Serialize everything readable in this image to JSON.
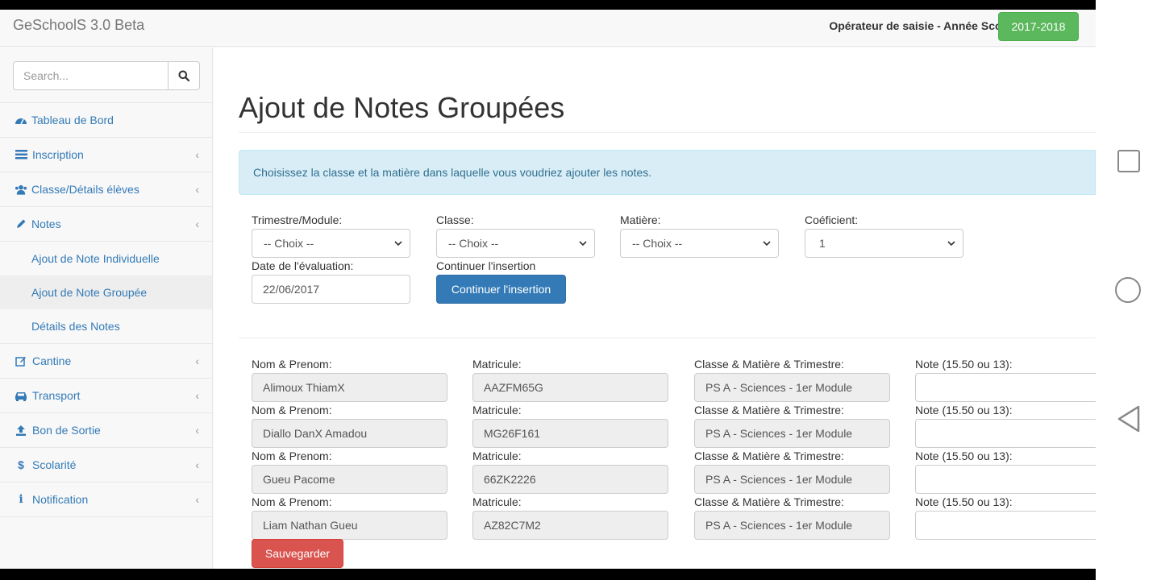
{
  "app": {
    "brand": "GeSchoolS 3.0 Beta",
    "operator_label": "Opérateur de saisie - Année Scolaire:",
    "school_year": "2017-2018"
  },
  "sidebar": {
    "search_placeholder": "Search...",
    "items": [
      {
        "label": "Tableau de Bord",
        "icon": "dashboard-icon",
        "expandable": false
      },
      {
        "label": "Inscription",
        "icon": "list-icon",
        "expandable": true
      },
      {
        "label": "Classe/Détails élèves",
        "icon": "users-icon",
        "expandable": true
      },
      {
        "label": "Notes",
        "icon": "pencil-icon",
        "expandable": true
      },
      {
        "label": "Cantine",
        "icon": "edit-icon",
        "expandable": true
      },
      {
        "label": "Transport",
        "icon": "car-icon",
        "expandable": true
      },
      {
        "label": "Bon de Sortie",
        "icon": "upload-icon",
        "expandable": true
      },
      {
        "label": "Scolarité",
        "icon": "dollar-icon",
        "expandable": true
      },
      {
        "label": "Notification",
        "icon": "info-icon",
        "expandable": true
      }
    ],
    "notes_submenu": [
      {
        "label": "Ajout de Note Individuelle",
        "active": false
      },
      {
        "label": "Ajout de Note Groupée",
        "active": true
      },
      {
        "label": "Détails des Notes",
        "active": false
      }
    ]
  },
  "page": {
    "title": "Ajout de Notes Groupées",
    "alert": "Choisissez la classe et la matière dans laquelle vous voudriez ajouter les notes."
  },
  "filters": {
    "trimestre_label": "Trimestre/Module:",
    "trimestre_value": "-- Choix --",
    "classe_label": "Classe:",
    "classe_value": "-- Choix --",
    "matiere_label": "Matière:",
    "matiere_value": "-- Choix --",
    "coef_label": "Coéficient:",
    "coef_value": "1",
    "date_label": "Date de l'évaluation:",
    "date_value": "22/06/2017",
    "continue_label": "Continuer l'insertion",
    "continue_button": "Continuer l'insertion"
  },
  "students": {
    "name_label": "Nom & Prenom:",
    "matricule_label": "Matricule:",
    "context_label": "Classe & Matière & Trimestre:",
    "note_label": "Note (15.50 ou 13):",
    "rows": [
      {
        "name": "Alimoux ThiamX",
        "matricule": "AAZFM65G",
        "context": "PS A - Sciences - 1er Module",
        "note": ""
      },
      {
        "name": "Diallo DanX Amadou",
        "matricule": "MG26F161",
        "context": "PS A - Sciences - 1er Module",
        "note": ""
      },
      {
        "name": "Gueu Pacome",
        "matricule": "66ZK2226",
        "context": "PS A - Sciences - 1er Module",
        "note": ""
      },
      {
        "name": "Liam Nathan Gueu",
        "matricule": "AZ82C7M2",
        "context": "PS A - Sciences - 1er Module",
        "note": ""
      }
    ]
  },
  "save_button": "Sauvegarder",
  "colors": {
    "link": "#337ab7",
    "success": "#5cb85c",
    "danger": "#d9534f",
    "info_bg": "#d9edf7",
    "info_text": "#31708f"
  },
  "android_nav": [
    "recents-square-icon",
    "home-circle-icon",
    "back-triangle-icon"
  ]
}
